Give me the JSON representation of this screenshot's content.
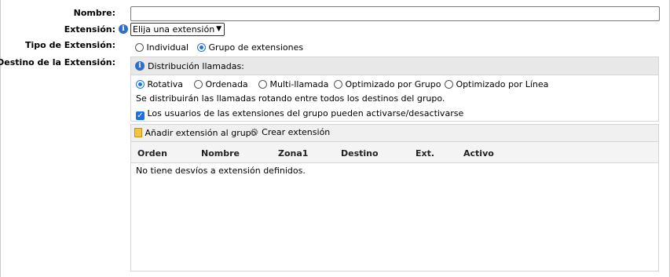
{
  "labels": {
    "nombre": "Nombre:",
    "extension": "Extensión:",
    "tipo": "Tipo de Extensión:",
    "destino": "Destino de la Extensión:"
  },
  "nombre_input": {
    "value": ""
  },
  "extension_select": {
    "selected": "Elija una extensión"
  },
  "tipo_options": [
    {
      "label": "Individual",
      "selected": false
    },
    {
      "label": "Grupo de extensiones",
      "selected": true
    }
  ],
  "distribution": {
    "title": "Distribución llamadas:",
    "options": [
      {
        "label": "Rotativa",
        "selected": true
      },
      {
        "label": "Ordenada",
        "selected": false
      },
      {
        "label": "Multi-llamada",
        "selected": false
      },
      {
        "label": "Optimizado por Grupo",
        "selected": false
      },
      {
        "label": "Optimizado por Línea",
        "selected": false
      }
    ],
    "description": "Se distribuirán las llamadas rotando entre todos los destinos del grupo.",
    "checkbox_label": "Los usuarios de las extensiones del grupo pueden activarse/desactivarse",
    "checkbox_checked": true
  },
  "toolbar": {
    "add_label": "Añadir extensión al grupo",
    "create_label": "Crear extensión"
  },
  "table": {
    "columns": [
      "Orden",
      "Nombre",
      "Zona1",
      "Destino",
      "Ext.",
      "Activo"
    ],
    "empty_message": "No tiene desvíos a extensión definidos."
  },
  "icons": {
    "info": "info-icon",
    "add": "document-add-icon",
    "create": "gear-icon",
    "dropdown": "chevron-down-icon",
    "check": "checkmark-icon"
  },
  "colors": {
    "accent": "#1a73e8",
    "info": "#2f6fc7",
    "panel_header": "#e8e8e8",
    "border": "#d6d6d6"
  }
}
